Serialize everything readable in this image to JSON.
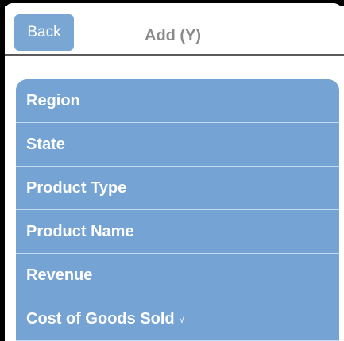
{
  "navbar": {
    "back_label": "Back",
    "title": "Add (Y)"
  },
  "list": {
    "items": [
      {
        "label": "Region",
        "checked": false
      },
      {
        "label": "State",
        "checked": false
      },
      {
        "label": "Product Type",
        "checked": false
      },
      {
        "label": "Product Name",
        "checked": false
      },
      {
        "label": "Revenue",
        "checked": false
      },
      {
        "label": "Cost of Goods Sold",
        "checked": true,
        "check_glyph": "√"
      }
    ]
  },
  "colors": {
    "accent": "#74a3d4",
    "button": "#7aa6d4",
    "title_text": "#8a8a8a",
    "divider": "#c5daf0"
  }
}
